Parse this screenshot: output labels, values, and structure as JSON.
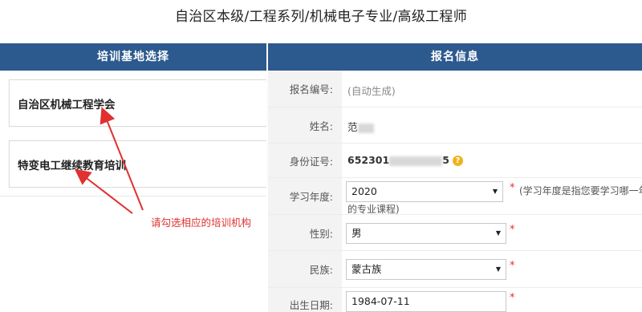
{
  "page": {
    "title": "自治区本级/工程系列/机械电子专业/高级工程师"
  },
  "left": {
    "header": "培训基地选择",
    "items": [
      {
        "label": "自治区机械工程学会"
      },
      {
        "label": "特变电工继续教育培训"
      }
    ],
    "annotation": "请勾选相应的培训机构"
  },
  "right": {
    "header": "报名信息",
    "fields": {
      "reg_no": {
        "label": "报名编号:",
        "value": "(自动生成)"
      },
      "name": {
        "label": "姓名:",
        "value": "范"
      },
      "id_no": {
        "label": "身份证号:",
        "prefix": "652301",
        "suffix": "5"
      },
      "year": {
        "label": "学习年度:",
        "value": "2020",
        "note_line1": "(学习年度是指您要学习哪一年度",
        "note_line2": "的专业课程)"
      },
      "gender": {
        "label": "性别:",
        "value": "男"
      },
      "ethnicity": {
        "label": "民族:",
        "value": "蒙古族"
      },
      "birth": {
        "label": "出生日期:",
        "value": "1984-07-11"
      }
    },
    "required_mark": "*",
    "help_icon_glyph": "?"
  },
  "colors": {
    "header_bg": "#2d5a8e",
    "annotation": "#e03030",
    "help_icon": "#f0b31c"
  }
}
